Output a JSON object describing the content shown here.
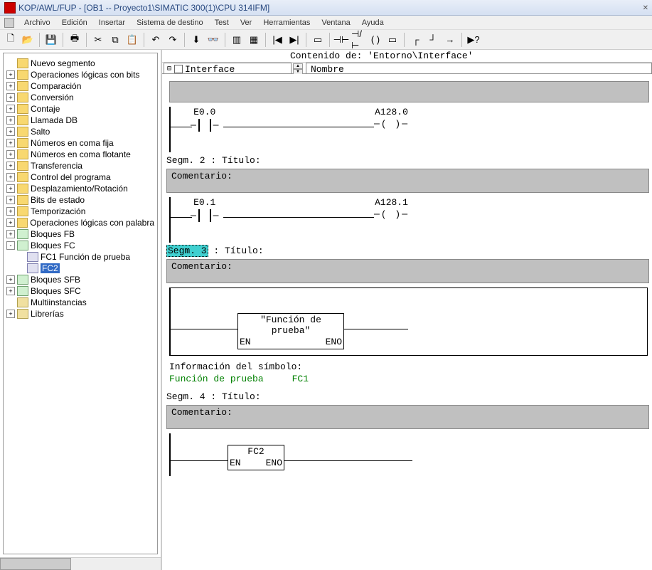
{
  "title": "KOP/AWL/FUP  - [OB1  -- Proyecto1\\SIMATIC 300(1)\\CPU 314IFM]",
  "menu": [
    "Archivo",
    "Edición",
    "Insertar",
    "Sistema de destino",
    "Test",
    "Ver",
    "Herramientas",
    "Ventana",
    "Ayuda"
  ],
  "tree": {
    "items": [
      {
        "icon": "seg",
        "label": "Nuevo segmento",
        "exp": ""
      },
      {
        "icon": "folder",
        "label": "Operaciones lógicas con bits",
        "exp": "+"
      },
      {
        "icon": "folder",
        "label": "Comparación",
        "exp": "+"
      },
      {
        "icon": "folder",
        "label": "Conversión",
        "exp": "+"
      },
      {
        "icon": "folder",
        "label": "Contaje",
        "exp": "+"
      },
      {
        "icon": "folder",
        "label": "Llamada DB",
        "exp": "+"
      },
      {
        "icon": "folder",
        "label": "Salto",
        "exp": "+"
      },
      {
        "icon": "folder",
        "label": "Números en coma fija",
        "exp": "+"
      },
      {
        "icon": "folder",
        "label": "Números en coma flotante",
        "exp": "+"
      },
      {
        "icon": "folder",
        "label": "Transferencia",
        "exp": "+"
      },
      {
        "icon": "folder",
        "label": "Control del programa",
        "exp": "+"
      },
      {
        "icon": "folder",
        "label": "Desplazamiento/Rotación",
        "exp": "+"
      },
      {
        "icon": "folder",
        "label": "Bits de estado",
        "exp": "+"
      },
      {
        "icon": "folder",
        "label": "Temporización",
        "exp": "+"
      },
      {
        "icon": "folder",
        "label": "Operaciones lógicas con palabra",
        "exp": "+"
      },
      {
        "icon": "block",
        "label": "Bloques FB",
        "exp": "+"
      },
      {
        "icon": "block",
        "label": "Bloques FC",
        "exp": "-",
        "children": [
          {
            "icon": "fc",
            "label": "FC1   Función de prueba"
          },
          {
            "icon": "fc",
            "label": "FC2",
            "selected": true
          }
        ]
      },
      {
        "icon": "block",
        "label": "Bloques SFB",
        "exp": "+"
      },
      {
        "icon": "block",
        "label": "Bloques SFC",
        "exp": "+"
      },
      {
        "icon": "lib",
        "label": "Multiinstancias",
        "exp": ""
      },
      {
        "icon": "lib",
        "label": "Librerías",
        "exp": "+"
      }
    ]
  },
  "interface": {
    "path_label": "Contenido de: 'Entorno\\Interface'",
    "selector": "Interface",
    "nombre_label": "Nombre"
  },
  "networks": {
    "net1": {
      "input": "E0.0",
      "output": "A128.0"
    },
    "seg2_title": "Segm. 2 : Título:",
    "seg2_comment": "Comentario:",
    "net2": {
      "input": "E0.1",
      "output": "A128.1"
    },
    "seg3_label": "Segm. 3",
    "seg3_title_suffix": " : Título:",
    "seg3_comment": "Comentario:",
    "fc1_box_title": "\"Función de prueba\"",
    "en": "EN",
    "eno": "ENO",
    "symbol_info_title": "Información del símbolo:",
    "symbol_name": "Función de prueba",
    "symbol_block": "FC1",
    "seg4_title": "Segm. 4 : Título:",
    "seg4_comment": "Comentario:",
    "fc2_box_title": "FC2"
  }
}
